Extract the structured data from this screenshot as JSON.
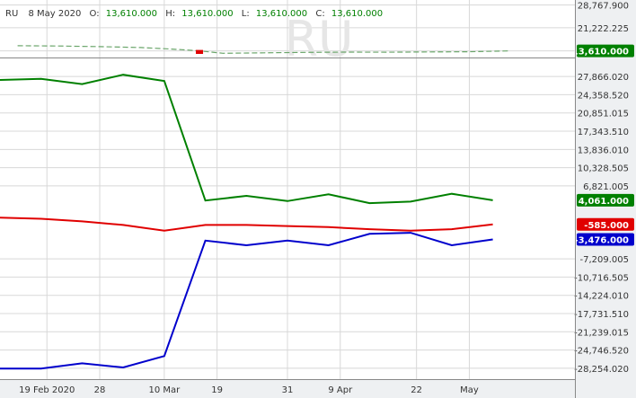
{
  "header": {
    "symbol": "RU",
    "date": "8 May 2020",
    "o_label": "O:",
    "o_value": "13,610.000",
    "h_label": "H:",
    "h_value": "13,610.000",
    "l_label": "L:",
    "l_value": "13,610.000",
    "c_label": "C:",
    "c_value": "13,610.000"
  },
  "watermark": "RU",
  "colors": {
    "green": "#008000",
    "red": "#e00000",
    "blue": "#0000cc",
    "grid": "#d8d8d8",
    "axis_bg": "#eef0f2"
  },
  "chart_data": [
    {
      "type": "line",
      "panel": "price",
      "title": "",
      "y_ticks": [
        "28,767.900",
        "21,222.225",
        "13,610.000"
      ],
      "last_value_label": "13,610.000",
      "series": [
        {
          "name": "",
          "style": "dashed",
          "x": [
            "2020-02-14",
            "2020-02-21",
            "2020-02-28",
            "2020-03-06",
            "2020-03-10",
            "2020-03-13",
            "2020-03-16",
            "2020-03-20",
            "2020-03-27",
            "2020-04-03",
            "2020-04-10",
            "2020-04-17",
            "2020-04-24",
            "2020-05-01",
            "2020-05-08"
          ],
          "values": [
            15300,
            15200,
            15000,
            14700,
            14300,
            14000,
            13600,
            12800,
            12950,
            13100,
            13200,
            13150,
            13250,
            13300,
            13610
          ]
        }
      ]
    },
    {
      "type": "line",
      "panel": "positions",
      "title": "",
      "ylim": [
        -30000,
        31000
      ],
      "y_ticks": [
        "27,866.020",
        "24,358.520",
        "20,851.015",
        "17,343.510",
        "13,836.010",
        "10,328.505",
        "6,821.005",
        "-7,209.005",
        "-10,716.505",
        "-14,224.010",
        "-17,731.510",
        "-21,239.015",
        "-24,746.520",
        "-28,254.020"
      ],
      "x_ticks": [
        "19 Feb 2020",
        "28",
        "10 Mar",
        "19",
        "31",
        "9 Apr",
        "22",
        "May"
      ],
      "x_tick_dates": [
        "2020-02-19",
        "2020-02-28",
        "2020-03-10",
        "2020-03-19",
        "2020-03-31",
        "2020-04-09",
        "2020-04-22",
        "2020-05-01"
      ],
      "x_range": [
        "2020-02-11",
        "2020-05-19"
      ],
      "x": [
        "2020-02-11",
        "2020-02-18",
        "2020-02-25",
        "2020-03-03",
        "2020-03-10",
        "2020-03-17",
        "2020-03-24",
        "2020-03-31",
        "2020-04-07",
        "2020-04-14",
        "2020-04-21",
        "2020-04-28",
        "2020-05-05"
      ],
      "series": [
        {
          "name": "",
          "color": "#008000",
          "last_label": "4,061.000",
          "values": [
            27200,
            27400,
            26400,
            28200,
            27000,
            4000,
            4900,
            3900,
            5200,
            3500,
            3800,
            5300,
            4061
          ]
        },
        {
          "name": "",
          "color": "#e00000",
          "last_label": "-585.000",
          "values": [
            700,
            500,
            0,
            -700,
            -1800,
            -700,
            -700,
            -900,
            -1100,
            -1500,
            -1800,
            -1500,
            -585
          ]
        },
        {
          "name": "",
          "color": "#0000cc",
          "last_label": "-3,476.000",
          "values": [
            -28300,
            -28300,
            -27300,
            -28100,
            -25900,
            -3700,
            -4600,
            -3700,
            -4600,
            -2400,
            -2200,
            -4600,
            -3476
          ]
        }
      ]
    }
  ]
}
